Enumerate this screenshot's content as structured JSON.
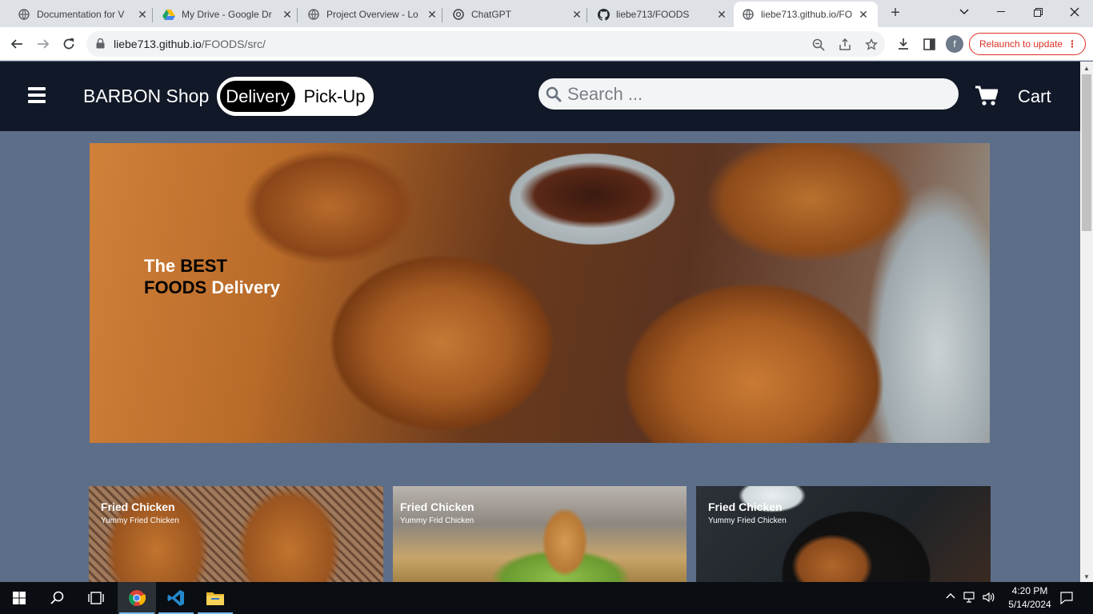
{
  "browser": {
    "tabs": [
      {
        "title": "Documentation for V",
        "icon": "globe-icon"
      },
      {
        "title": "My Drive - Google Dr",
        "icon": "google-drive-icon"
      },
      {
        "title": "Project Overview - Lo",
        "icon": "globe-icon"
      },
      {
        "title": "ChatGPT",
        "icon": "chatgpt-icon"
      },
      {
        "title": "liebe713/FOODS",
        "icon": "github-icon"
      },
      {
        "title": "liebe713.github.io/FO",
        "icon": "globe-icon",
        "active": true
      }
    ],
    "url_host": "liebe713.github.io",
    "url_path": "/FOODS/src/",
    "profile_initial": "f",
    "relaunch_label": "Relaunch to update"
  },
  "header": {
    "brand": "BARBON Shop",
    "delivery_label": "Delivery",
    "pickup_label": "Pick-Up",
    "search_placeholder": "Search ...",
    "cart_label": "Cart"
  },
  "hero": {
    "line1_white": "The",
    "line1_black": "BEST",
    "line2_black": "FOODS",
    "line2_white": "Delivery"
  },
  "cards": [
    {
      "title": "Fried Chicken",
      "subtitle": "Yummy Fried Chicken"
    },
    {
      "title": "Fried Chicken",
      "subtitle": "Yummy Frid Chicken"
    },
    {
      "title": "Fried Chicken",
      "subtitle": "Yummy Fried Chicken"
    }
  ],
  "taskbar": {
    "time": "4:20 PM",
    "date": "5/14/2024"
  },
  "colors": {
    "site_header_bg": "#111827",
    "page_bg": "#5d6e89",
    "relaunch_red": "#d93025"
  }
}
